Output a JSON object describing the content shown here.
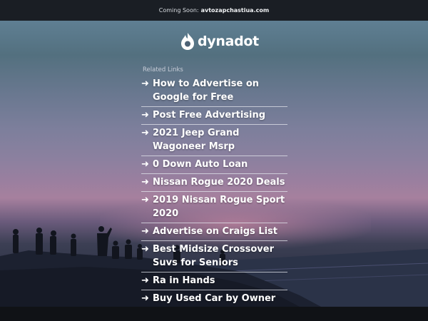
{
  "topbar": {
    "prefix": "Coming Soon:",
    "domain": "avtozapchastiua.com"
  },
  "logo": {
    "text": "dynadot",
    "icon": "dynadot-flame-icon"
  },
  "related": {
    "heading": "Related Links",
    "arrow": "➜",
    "links": [
      "How to Advertise on Google for Free",
      "Post Free Advertising",
      "2021 Jeep Grand Wagoneer Msrp",
      "0 Down Auto Loan",
      "Nissan Rogue 2020 Deals",
      "2019 Nissan Rogue Sport 2020",
      "Advertise on Craigs List",
      "Best Midsize Crossover Suvs for Seniors",
      "Ra in Hands",
      "Buy Used Car by Owner"
    ]
  },
  "colors": {
    "topbar": "#1a1e24",
    "text": "#ffffff",
    "divider": "#e1e4eb"
  }
}
